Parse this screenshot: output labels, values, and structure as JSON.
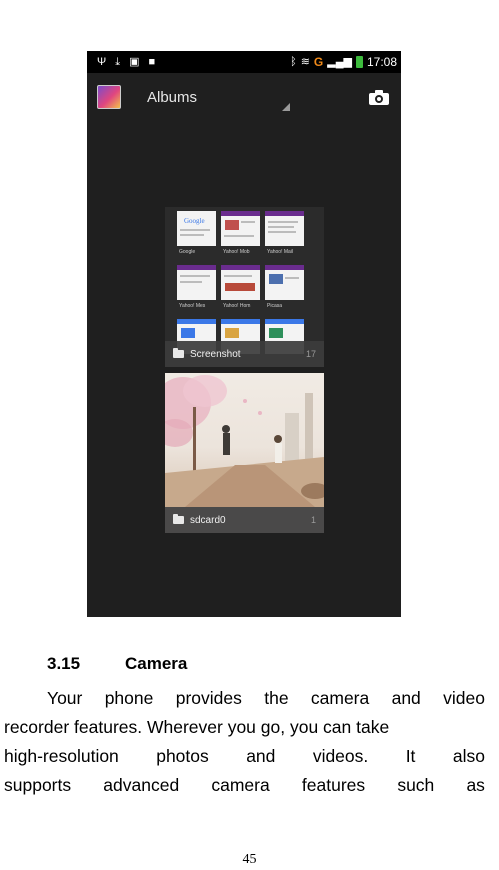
{
  "phone": {
    "statusbar": {
      "carrier": "G",
      "time": "17:08"
    },
    "actionbar": {
      "title": "Albums"
    },
    "albums": [
      {
        "name": "Screenshot",
        "count": "17",
        "thumbnails": [
          "Google",
          "Yahoo! Mob",
          "Yahoo! Mail",
          "Yahoo! Mes",
          "Yahoo! Hom",
          "Picasa"
        ]
      },
      {
        "name": "sdcard0",
        "count": "1"
      }
    ]
  },
  "section": {
    "number": "3.15",
    "title": "Camera"
  },
  "paragraph": {
    "lines": [
      [
        "Your",
        "phone",
        "provides",
        "the",
        "camera",
        "and",
        "video"
      ],
      "recorder features. Wherever you go, you can take",
      [
        "high-resolution",
        "photos",
        "and",
        "videos.",
        "It",
        "also"
      ],
      [
        "supports",
        "advanced",
        "camera",
        "features",
        "such",
        "as"
      ]
    ]
  },
  "page_number": "45"
}
